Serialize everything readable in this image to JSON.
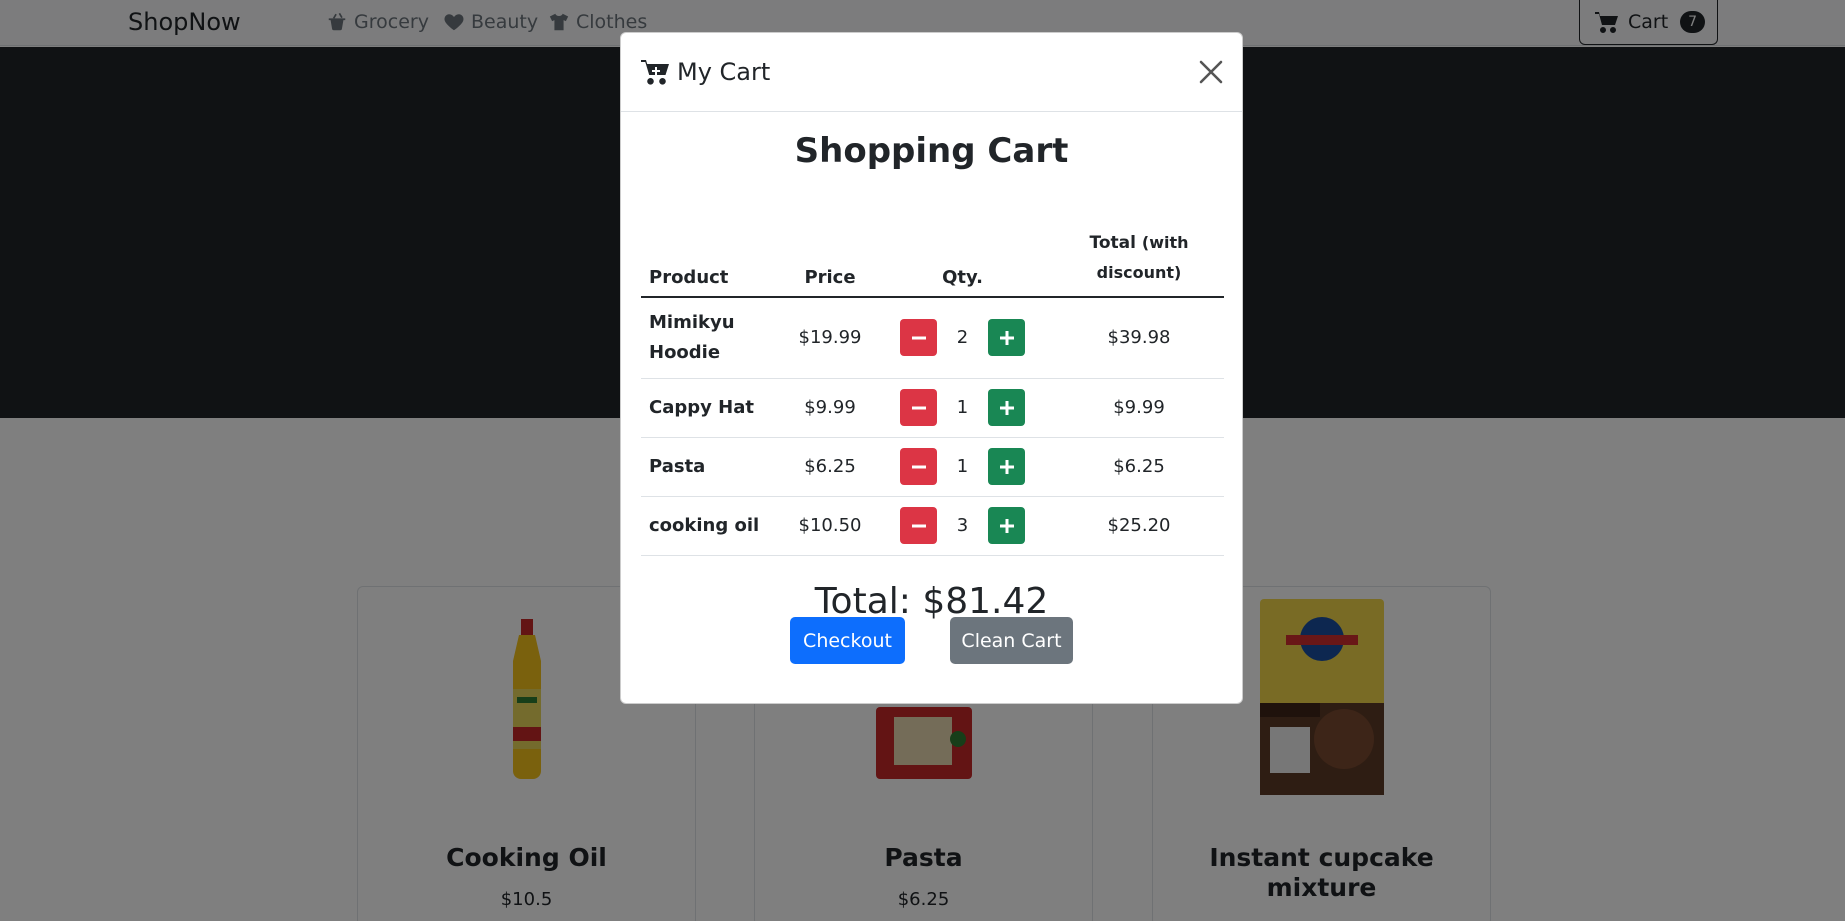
{
  "navbar": {
    "brand": "ShopNow",
    "links": [
      {
        "label": "Grocery",
        "icon": "basket-icon"
      },
      {
        "label": "Beauty",
        "icon": "heart-icon"
      },
      {
        "label": "Clothes",
        "icon": "shirt-icon"
      }
    ],
    "cart": {
      "label": "Cart",
      "count": "7",
      "icon": "cart-icon"
    }
  },
  "products": [
    {
      "name": "Cooking Oil",
      "price": "$10.5"
    },
    {
      "name": "Pasta",
      "price": "$6.25"
    },
    {
      "name": "Instant cupcake mixture",
      "price": ""
    }
  ],
  "modal": {
    "title": "My Cart",
    "heading": "Shopping Cart",
    "columns": {
      "product": "Product",
      "price": "Price",
      "qty": "Qty.",
      "total": "Total",
      "total_note": "(with discount)"
    },
    "items": [
      {
        "product": "Mimikyu Hoodie",
        "price": "$19.99",
        "qty": "2",
        "total": "$39.98"
      },
      {
        "product": "Cappy Hat",
        "price": "$9.99",
        "qty": "1",
        "total": "$9.99"
      },
      {
        "product": "Pasta",
        "price": "$6.25",
        "qty": "1",
        "total": "$6.25"
      },
      {
        "product": "cooking oil",
        "price": "$10.50",
        "qty": "3",
        "total": "$25.20"
      }
    ],
    "grand_total": "Total: $81.42",
    "checkout_label": "Checkout",
    "clean_label": "Clean Cart"
  },
  "colors": {
    "primary": "#0d6efd",
    "secondary": "#6c757d",
    "danger": "#dc3545",
    "success": "#198754",
    "dark": "#212529"
  }
}
